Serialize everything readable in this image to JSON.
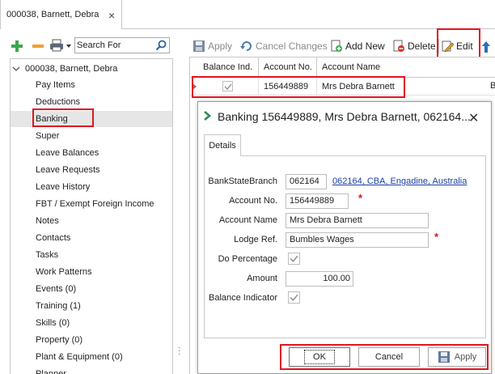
{
  "document_tab": {
    "label": "000038, Barnett, Debra"
  },
  "left_panel": {
    "search_placeholder": "Search For",
    "tree_root": "000038, Barnett, Debra",
    "tree_items": [
      "Pay Items",
      "Deductions",
      "Banking",
      "Super",
      "Leave Balances",
      "Leave Requests",
      "Leave History",
      "FBT / Exempt Foreign Income",
      "Notes",
      "Contacts",
      "Tasks",
      "Work Patterns",
      "Events (0)",
      "Training (1)",
      "Skills (0)",
      "Property (0)",
      "Plant & Equipment (0)",
      "Planner"
    ],
    "selected_item": "Banking"
  },
  "toolbar": {
    "apply": "Apply",
    "cancel_changes": "Cancel Changes",
    "add_new": "Add New",
    "delete": "Delete",
    "edit": "Edit"
  },
  "grid": {
    "columns": [
      "Balance Ind.",
      "Account No.",
      "Account Name"
    ],
    "rows": [
      {
        "balance_ind": true,
        "account_no": "156449889",
        "account_name": "Mrs Debra Barnett"
      }
    ],
    "overflow_char": "B"
  },
  "dialog": {
    "title": "Banking 156449889, Mrs Debra Barnett, 062164...",
    "tab": "Details",
    "fields": {
      "bsb_label": "BankStateBranch",
      "bsb_value": "062164",
      "bsb_link": "062164, CBA, Engadine, Australia",
      "account_no_label": "Account No.",
      "account_no_value": "156449889",
      "account_name_label": "Account Name",
      "account_name_value": "Mrs Debra Barnett",
      "lodge_ref_label": "Lodge Ref.",
      "lodge_ref_value": "Bumbles Wages",
      "do_percentage_label": "Do Percentage",
      "do_percentage_checked": true,
      "amount_label": "Amount",
      "amount_value": "100.00",
      "balance_indicator_label": "Balance Indicator",
      "balance_indicator_checked": true,
      "required_mark": "*"
    },
    "buttons": {
      "ok": "OK",
      "cancel": "Cancel",
      "apply": "Apply"
    }
  },
  "colors": {
    "highlight": "#e0141e",
    "link": "#1a3ea8",
    "plus_icon": "#3aa84a",
    "minus_icon": "#f0a030",
    "dialog_chevron": "#2e8b57"
  }
}
